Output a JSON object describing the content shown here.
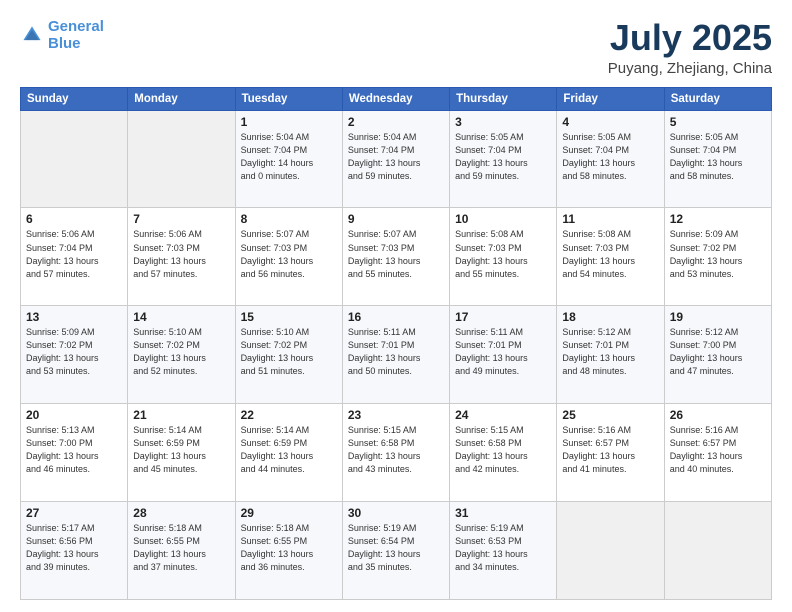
{
  "header": {
    "logo_line1": "General",
    "logo_line2": "Blue",
    "month": "July 2025",
    "location": "Puyang, Zhejiang, China"
  },
  "weekdays": [
    "Sunday",
    "Monday",
    "Tuesday",
    "Wednesday",
    "Thursday",
    "Friday",
    "Saturday"
  ],
  "weeks": [
    [
      {
        "day": "",
        "info": ""
      },
      {
        "day": "",
        "info": ""
      },
      {
        "day": "1",
        "info": "Sunrise: 5:04 AM\nSunset: 7:04 PM\nDaylight: 14 hours\nand 0 minutes."
      },
      {
        "day": "2",
        "info": "Sunrise: 5:04 AM\nSunset: 7:04 PM\nDaylight: 13 hours\nand 59 minutes."
      },
      {
        "day": "3",
        "info": "Sunrise: 5:05 AM\nSunset: 7:04 PM\nDaylight: 13 hours\nand 59 minutes."
      },
      {
        "day": "4",
        "info": "Sunrise: 5:05 AM\nSunset: 7:04 PM\nDaylight: 13 hours\nand 58 minutes."
      },
      {
        "day": "5",
        "info": "Sunrise: 5:05 AM\nSunset: 7:04 PM\nDaylight: 13 hours\nand 58 minutes."
      }
    ],
    [
      {
        "day": "6",
        "info": "Sunrise: 5:06 AM\nSunset: 7:04 PM\nDaylight: 13 hours\nand 57 minutes."
      },
      {
        "day": "7",
        "info": "Sunrise: 5:06 AM\nSunset: 7:03 PM\nDaylight: 13 hours\nand 57 minutes."
      },
      {
        "day": "8",
        "info": "Sunrise: 5:07 AM\nSunset: 7:03 PM\nDaylight: 13 hours\nand 56 minutes."
      },
      {
        "day": "9",
        "info": "Sunrise: 5:07 AM\nSunset: 7:03 PM\nDaylight: 13 hours\nand 55 minutes."
      },
      {
        "day": "10",
        "info": "Sunrise: 5:08 AM\nSunset: 7:03 PM\nDaylight: 13 hours\nand 55 minutes."
      },
      {
        "day": "11",
        "info": "Sunrise: 5:08 AM\nSunset: 7:03 PM\nDaylight: 13 hours\nand 54 minutes."
      },
      {
        "day": "12",
        "info": "Sunrise: 5:09 AM\nSunset: 7:02 PM\nDaylight: 13 hours\nand 53 minutes."
      }
    ],
    [
      {
        "day": "13",
        "info": "Sunrise: 5:09 AM\nSunset: 7:02 PM\nDaylight: 13 hours\nand 53 minutes."
      },
      {
        "day": "14",
        "info": "Sunrise: 5:10 AM\nSunset: 7:02 PM\nDaylight: 13 hours\nand 52 minutes."
      },
      {
        "day": "15",
        "info": "Sunrise: 5:10 AM\nSunset: 7:02 PM\nDaylight: 13 hours\nand 51 minutes."
      },
      {
        "day": "16",
        "info": "Sunrise: 5:11 AM\nSunset: 7:01 PM\nDaylight: 13 hours\nand 50 minutes."
      },
      {
        "day": "17",
        "info": "Sunrise: 5:11 AM\nSunset: 7:01 PM\nDaylight: 13 hours\nand 49 minutes."
      },
      {
        "day": "18",
        "info": "Sunrise: 5:12 AM\nSunset: 7:01 PM\nDaylight: 13 hours\nand 48 minutes."
      },
      {
        "day": "19",
        "info": "Sunrise: 5:12 AM\nSunset: 7:00 PM\nDaylight: 13 hours\nand 47 minutes."
      }
    ],
    [
      {
        "day": "20",
        "info": "Sunrise: 5:13 AM\nSunset: 7:00 PM\nDaylight: 13 hours\nand 46 minutes."
      },
      {
        "day": "21",
        "info": "Sunrise: 5:14 AM\nSunset: 6:59 PM\nDaylight: 13 hours\nand 45 minutes."
      },
      {
        "day": "22",
        "info": "Sunrise: 5:14 AM\nSunset: 6:59 PM\nDaylight: 13 hours\nand 44 minutes."
      },
      {
        "day": "23",
        "info": "Sunrise: 5:15 AM\nSunset: 6:58 PM\nDaylight: 13 hours\nand 43 minutes."
      },
      {
        "day": "24",
        "info": "Sunrise: 5:15 AM\nSunset: 6:58 PM\nDaylight: 13 hours\nand 42 minutes."
      },
      {
        "day": "25",
        "info": "Sunrise: 5:16 AM\nSunset: 6:57 PM\nDaylight: 13 hours\nand 41 minutes."
      },
      {
        "day": "26",
        "info": "Sunrise: 5:16 AM\nSunset: 6:57 PM\nDaylight: 13 hours\nand 40 minutes."
      }
    ],
    [
      {
        "day": "27",
        "info": "Sunrise: 5:17 AM\nSunset: 6:56 PM\nDaylight: 13 hours\nand 39 minutes."
      },
      {
        "day": "28",
        "info": "Sunrise: 5:18 AM\nSunset: 6:55 PM\nDaylight: 13 hours\nand 37 minutes."
      },
      {
        "day": "29",
        "info": "Sunrise: 5:18 AM\nSunset: 6:55 PM\nDaylight: 13 hours\nand 36 minutes."
      },
      {
        "day": "30",
        "info": "Sunrise: 5:19 AM\nSunset: 6:54 PM\nDaylight: 13 hours\nand 35 minutes."
      },
      {
        "day": "31",
        "info": "Sunrise: 5:19 AM\nSunset: 6:53 PM\nDaylight: 13 hours\nand 34 minutes."
      },
      {
        "day": "",
        "info": ""
      },
      {
        "day": "",
        "info": ""
      }
    ]
  ]
}
